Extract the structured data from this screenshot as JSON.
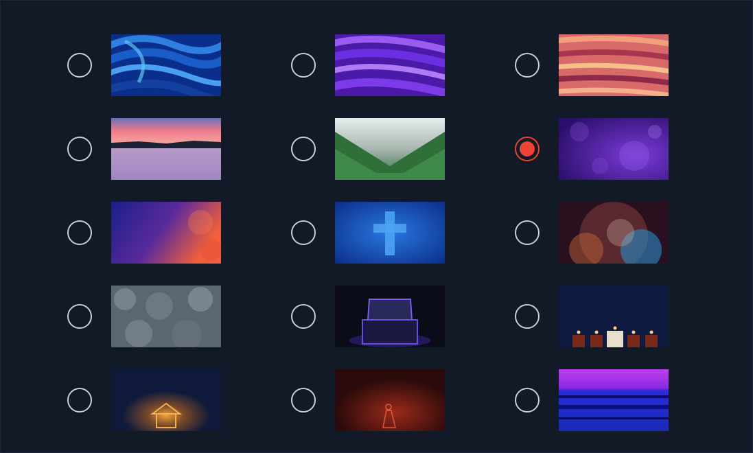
{
  "accent_color": "#ee4433",
  "selected_index": 5,
  "backgrounds": [
    {
      "name": "blue-swirl-icon"
    },
    {
      "name": "purple-swirl-icon"
    },
    {
      "name": "coral-swirl-icon"
    },
    {
      "name": "sunset-lake-icon"
    },
    {
      "name": "misty-forest-icon"
    },
    {
      "name": "purple-texture-icon"
    },
    {
      "name": "blue-red-texture-icon"
    },
    {
      "name": "blue-cross-icon"
    },
    {
      "name": "abstract-grunge-icon"
    },
    {
      "name": "snowy-forest-icon"
    },
    {
      "name": "glowing-box-icon"
    },
    {
      "name": "advent-candles-icon"
    },
    {
      "name": "stable-light-icon"
    },
    {
      "name": "red-nativity-icon"
    },
    {
      "name": "magenta-blue-stripes-icon"
    }
  ]
}
